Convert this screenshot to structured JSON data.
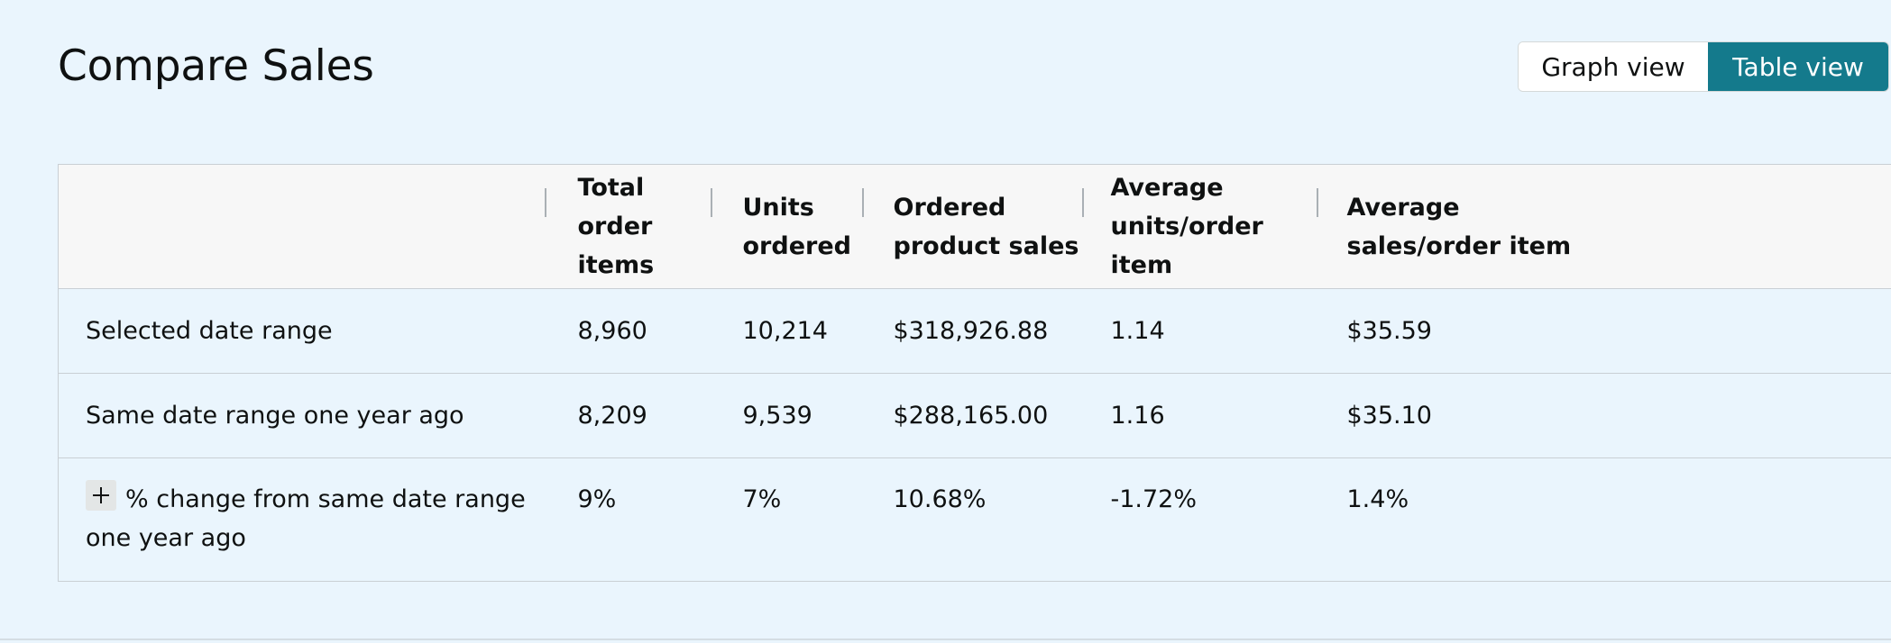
{
  "header": {
    "title": "Compare Sales"
  },
  "view_toggle": {
    "graph_label": "Graph view",
    "table_label": "Table view",
    "selected": "Table view"
  },
  "table": {
    "columns": [
      "",
      "Total order items",
      "Units ordered",
      "Ordered product sales",
      "Average units/order item",
      "Average sales/order item"
    ],
    "rows": [
      {
        "label": "Selected date range",
        "cells": [
          "8,960",
          "10,214",
          "$318,926.88",
          "1.14",
          "$35.59"
        ]
      },
      {
        "label": "Same date range one year ago",
        "cells": [
          "8,209",
          "9,539",
          "$288,165.00",
          "1.16",
          "$35.10"
        ]
      },
      {
        "label": "% change from same date range one year ago",
        "cells": [
          "9%",
          "7%",
          "10.68%",
          "-1.72%",
          "1.4%"
        ]
      }
    ]
  },
  "colors": {
    "background": "#eaf5fd",
    "accent": "#147a8c",
    "positive": "#067d07",
    "negative": "#e3001b",
    "header_row": "#f7f7f7"
  },
  "icons": {
    "expand": "plus-icon"
  }
}
